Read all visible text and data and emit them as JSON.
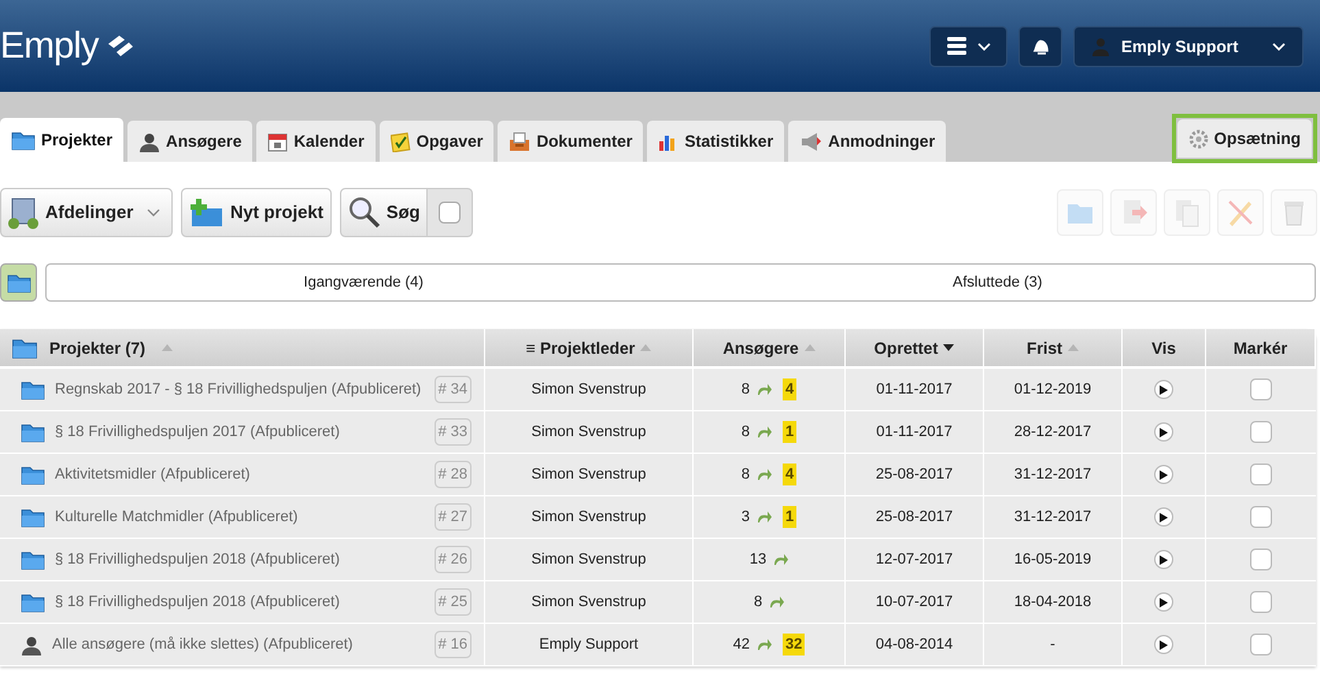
{
  "header": {
    "logo": "Emply",
    "user": "Emply Support"
  },
  "tabs": [
    {
      "label": "Projekter",
      "selected": true
    },
    {
      "label": "Ansøgere",
      "selected": false
    },
    {
      "label": "Kalender",
      "selected": false
    },
    {
      "label": "Opgaver",
      "selected": false
    },
    {
      "label": "Dokumenter",
      "selected": false
    },
    {
      "label": "Statistikker",
      "selected": false
    },
    {
      "label": "Anmodninger",
      "selected": false
    }
  ],
  "settings_tab": {
    "label": "Opsætning",
    "highlighted": true
  },
  "toolbar": {
    "departments": "Afdelinger",
    "new_project": "Nyt projekt",
    "search": "Søg"
  },
  "stages": [
    {
      "label": "Igangværende (4)"
    },
    {
      "label": "Afsluttede (3)"
    }
  ],
  "table": {
    "columns": [
      {
        "label": "Projekter (7)",
        "sorted": false
      },
      {
        "label": "≡ Projektleder",
        "sorted": false
      },
      {
        "label": "Ansøgere",
        "sorted": false
      },
      {
        "label": "Oprettet",
        "sorted": true
      },
      {
        "label": "Frist",
        "sorted": false
      },
      {
        "label": "Vis"
      },
      {
        "label": "Markér"
      }
    ],
    "rows": [
      {
        "kind": "project",
        "name": "Regnskab 2017 - § 18 Frivillighedspuljen (Afpubliceret)",
        "number": "# 34",
        "leader": "Simon Svenstrup",
        "applicants": "8",
        "new": "4",
        "created": "01-11-2017",
        "deadline": "01-12-2019",
        "checked": false
      },
      {
        "kind": "project",
        "name": "§ 18 Frivillighedspuljen 2017 (Afpubliceret)",
        "number": "# 33",
        "leader": "Simon Svenstrup",
        "applicants": "8",
        "new": "1",
        "created": "01-11-2017",
        "deadline": "28-12-2017",
        "checked": false
      },
      {
        "kind": "project",
        "name": "Aktivitetsmidler (Afpubliceret)",
        "number": "# 28",
        "leader": "Simon Svenstrup",
        "applicants": "8",
        "new": "4",
        "created": "25-08-2017",
        "deadline": "31-12-2017",
        "checked": false
      },
      {
        "kind": "project",
        "name": "Kulturelle Matchmidler (Afpubliceret)",
        "number": "# 27",
        "leader": "Simon Svenstrup",
        "applicants": "3",
        "new": "1",
        "created": "25-08-2017",
        "deadline": "31-12-2017",
        "checked": false
      },
      {
        "kind": "project",
        "name": "§ 18 Frivillighedspuljen 2018 (Afpubliceret)",
        "number": "# 26",
        "leader": "Simon Svenstrup",
        "applicants": "13",
        "created": "12-07-2017",
        "deadline": "16-05-2019",
        "checked": false
      },
      {
        "kind": "project",
        "name": "§ 18 Frivillighedspuljen 2018 (Afpubliceret)",
        "number": "# 25",
        "leader": "Simon Svenstrup",
        "applicants": "8",
        "created": "10-07-2017",
        "deadline": "18-04-2018",
        "checked": false
      },
      {
        "kind": "group",
        "name": "Alle ansøgere (må ikke slettes) (Afpubliceret)",
        "number": "# 16",
        "leader": "Emply Support",
        "applicants": "42",
        "new": "32",
        "created": "04-08-2014",
        "deadline": "-",
        "checked": false
      }
    ]
  }
}
